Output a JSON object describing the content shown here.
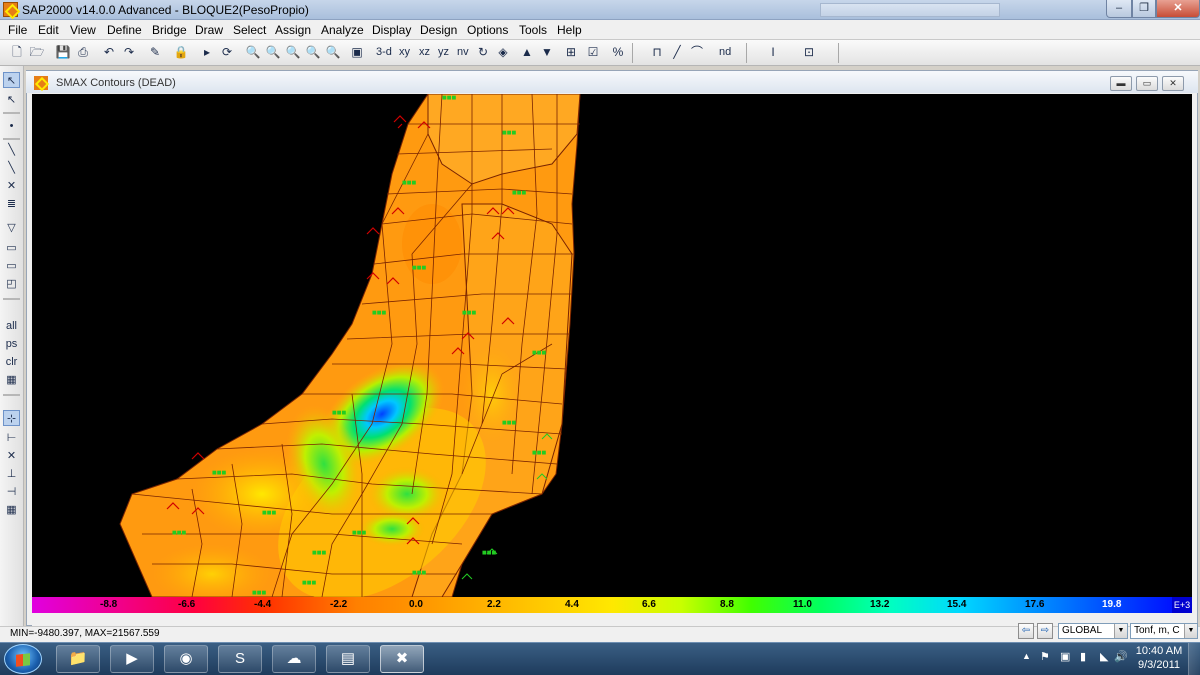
{
  "window": {
    "title": "SAP2000 v14.0.0 Advanced  - BLOQUE2(PesoPropio)",
    "min_label": "–",
    "max_label": "❐",
    "close_label": "✕"
  },
  "menu": [
    "File",
    "Edit",
    "View",
    "Define",
    "Bridge",
    "Draw",
    "Select",
    "Assign",
    "Analyze",
    "Display",
    "Design",
    "Options",
    "Tools",
    "Help"
  ],
  "toolbar": {
    "view_3d": "3-d",
    "view_xy": "xy",
    "view_xz": "xz",
    "view_yz": "yz",
    "view_nv": "nv",
    "view_nd": "nd"
  },
  "left_tools": {
    "select_all": "all",
    "previous_selection": "ps",
    "clear_selection": "clr"
  },
  "display_window": {
    "title": "SMAX Contours  (DEAD)"
  },
  "legend": {
    "values": [
      "-8.8",
      "-6.6",
      "-4.4",
      "-2.2",
      "0.0",
      "2.2",
      "4.4",
      "6.6",
      "8.8",
      "11.0",
      "13.2",
      "15.4",
      "17.6",
      "19.8"
    ],
    "end_label": "E+3"
  },
  "status": {
    "min_max": "MIN=-9480.397, MAX=21567.559",
    "coord_system": "GLOBAL",
    "units": "Tonf, m, C"
  },
  "taskbar": {
    "apps": [
      "explorer",
      "media-player",
      "chrome",
      "skype",
      "network",
      "sap2000-20",
      "sap2000"
    ],
    "time": "10:40 AM",
    "date": "9/3/2011"
  },
  "colors": {
    "model_orange": "#ff9a10",
    "model_edge": "#8b2500",
    "background": "#000000",
    "label_green": "#22cc22"
  }
}
